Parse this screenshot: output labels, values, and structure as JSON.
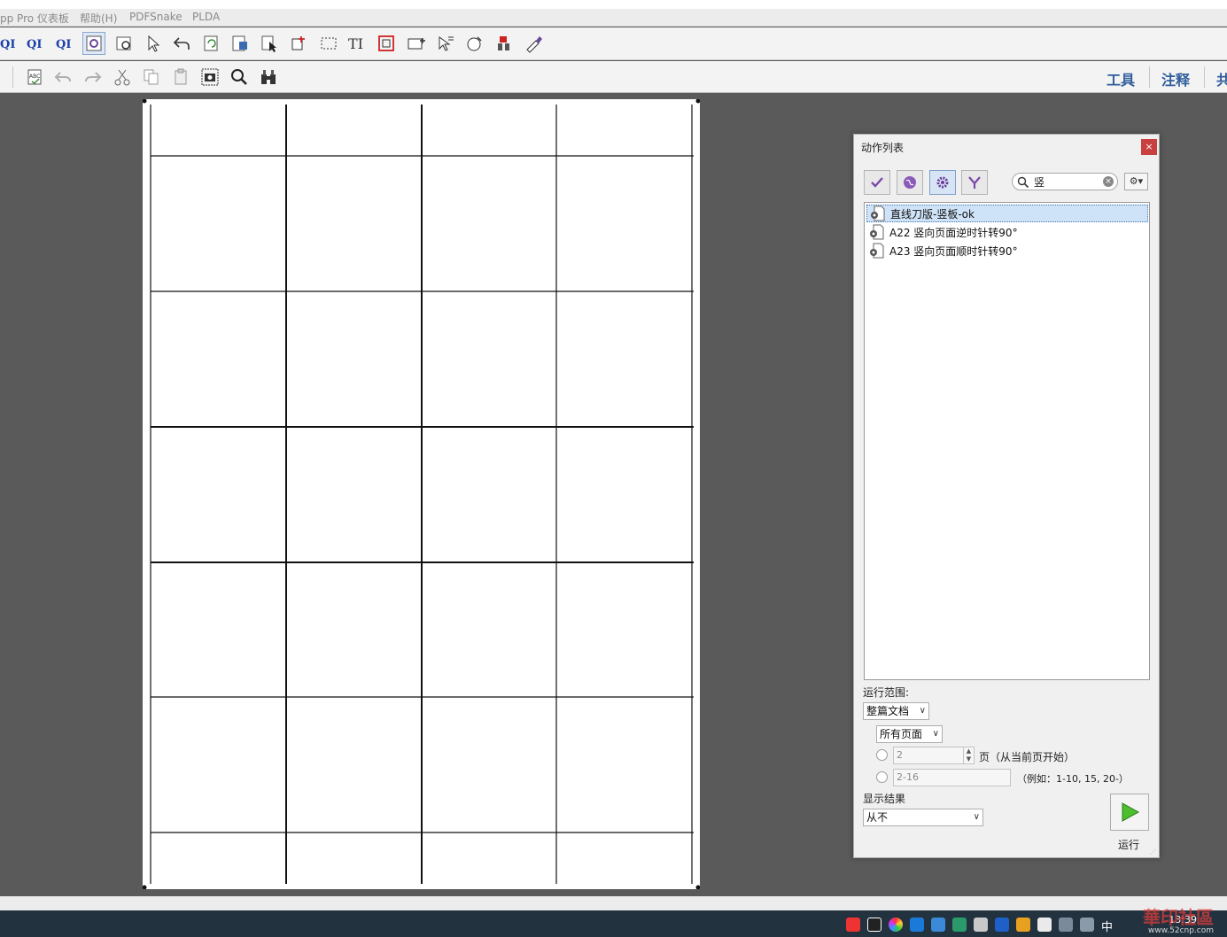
{
  "menubar": {
    "items": [
      "pp Pro 仪表板",
      "帮助(H)",
      "PDFSnake",
      "PLDA"
    ]
  },
  "toolbar": {
    "right_links": [
      "工具",
      "注释",
      "共"
    ]
  },
  "dialog": {
    "title": "动作列表",
    "close_label": "×",
    "search_value": "竖",
    "gear_label": "⚙▾",
    "actions": [
      {
        "label": "直线刀版-竖板-ok",
        "selected": true
      },
      {
        "label": "A22 竖向页面逆时针转90°",
        "selected": false
      },
      {
        "label": "A23 竖向页面顺时针转90°",
        "selected": false
      }
    ],
    "run_scope_label": "运行范围:",
    "scope_select": "整篇文档",
    "pages_select": "所有页面",
    "page_count_value": "2",
    "page_count_suffix": "页（从当前页开始）",
    "page_range_value": "2-16",
    "page_range_hint": "（例如：1-10, 15, 20-）",
    "show_result_label": "显示结果",
    "show_result_select": "从不",
    "run_label": "运行"
  },
  "taskbar": {
    "ime": "中",
    "clock": "13:39"
  },
  "watermark": {
    "text": "華印社區",
    "url": "www.52cnp.com"
  }
}
